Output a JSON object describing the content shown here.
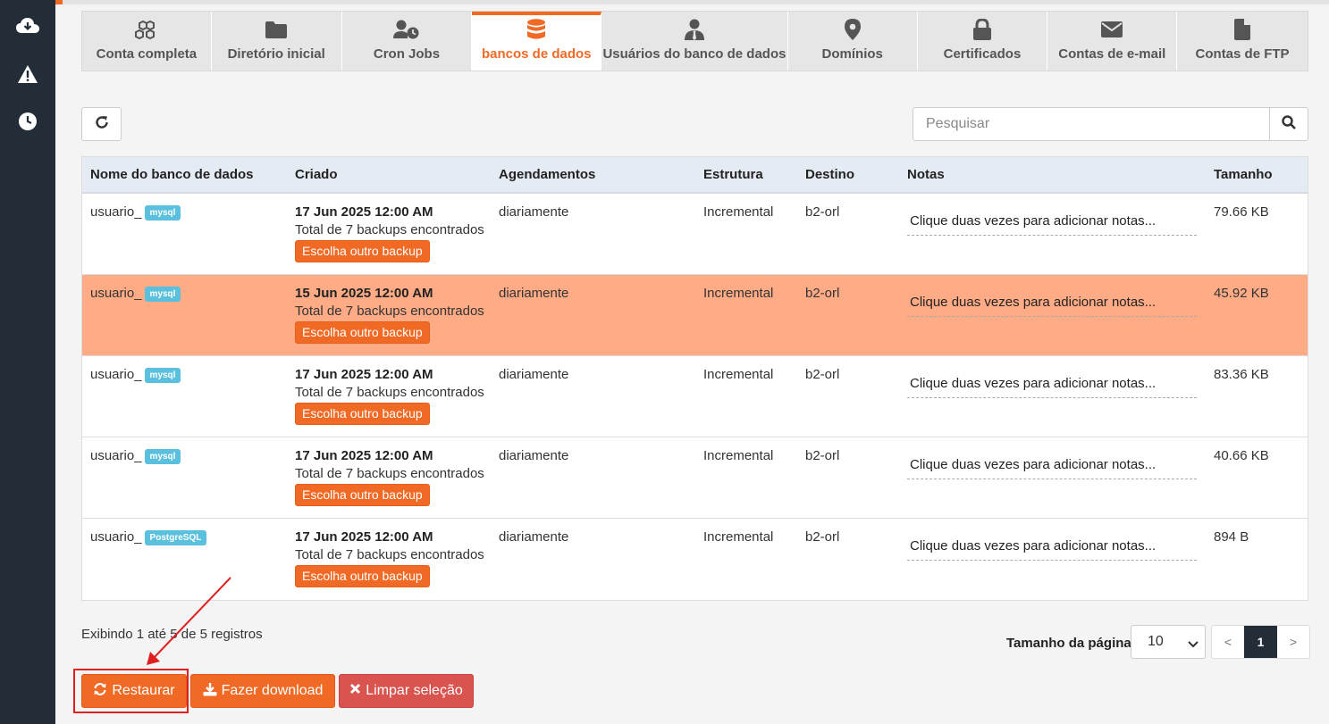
{
  "sidebar": {
    "icons": [
      "cloud-download-icon",
      "warning-icon",
      "clock-icon"
    ]
  },
  "tabs": [
    {
      "label": "Conta completa",
      "icon": "cubes-icon",
      "active": false
    },
    {
      "label": "Diretório inicial",
      "icon": "folder-icon",
      "active": false
    },
    {
      "label": "Cron Jobs",
      "icon": "user-clock-icon",
      "active": false
    },
    {
      "label": "bancos de dados",
      "icon": "database-icon",
      "active": true
    },
    {
      "label": "Usuários do banco de dados",
      "icon": "user-tie-icon",
      "active": false
    },
    {
      "label": "Domínios",
      "icon": "map-marker-icon",
      "active": false
    },
    {
      "label": "Certificados",
      "icon": "lock-icon",
      "active": false
    },
    {
      "label": "Contas de e-mail",
      "icon": "envelope-icon",
      "active": false
    },
    {
      "label": "Contas de FTP",
      "icon": "file-icon",
      "active": false
    }
  ],
  "search": {
    "placeholder": "Pesquisar",
    "value": ""
  },
  "table": {
    "headers": [
      "Nome do banco de dados",
      "Criado",
      "Agendamentos",
      "Estrutura",
      "Destino",
      "Notas",
      "Tamanho"
    ],
    "rows": [
      {
        "name": "usuario_",
        "type": "mysql",
        "date": "17 Jun 2025 12:00 AM",
        "total": "Total de 7 backups encontrados",
        "pick": "Escolha outro backup",
        "schedule": "diariamente",
        "structure": "Incremental",
        "destination": "b2-orl",
        "notes": "Clique duas vezes para adicionar notas...",
        "size": "79.66 KB",
        "selected": false
      },
      {
        "name": "usuario_",
        "type": "mysql",
        "date": "15 Jun 2025 12:00 AM",
        "total": "Total de 7 backups encontrados",
        "pick": "Escolha outro backup",
        "schedule": "diariamente",
        "structure": "Incremental",
        "destination": "b2-orl",
        "notes": "Clique duas vezes para adicionar notas...",
        "size": "45.92 KB",
        "selected": true
      },
      {
        "name": "usuario_",
        "type": "mysql",
        "date": "17 Jun 2025 12:00 AM",
        "total": "Total de 7 backups encontrados",
        "pick": "Escolha outro backup",
        "schedule": "diariamente",
        "structure": "Incremental",
        "destination": "b2-orl",
        "notes": "Clique duas vezes para adicionar notas...",
        "size": "83.36 KB",
        "selected": false
      },
      {
        "name": "usuario_",
        "type": "mysql",
        "date": "17 Jun 2025 12:00 AM",
        "total": "Total de 7 backups encontrados",
        "pick": "Escolha outro backup",
        "schedule": "diariamente",
        "structure": "Incremental",
        "destination": "b2-orl",
        "notes": "Clique duas vezes para adicionar notas...",
        "size": "40.66 KB",
        "selected": false
      },
      {
        "name": "usuario_",
        "type": "PostgreSQL",
        "date": "17 Jun 2025 12:00 AM",
        "total": "Total de 7 backups encontrados",
        "pick": "Escolha outro backup",
        "schedule": "diariamente",
        "structure": "Incremental",
        "destination": "b2-orl",
        "notes": "Clique duas vezes para adicionar notas...",
        "size": "894 B",
        "selected": false
      }
    ]
  },
  "footer": {
    "info": "Exibindo 1 até 5 de 5 registros",
    "page_size_label": "Tamanho da página",
    "page_size_value": "10",
    "pager": {
      "prev": "<",
      "current": "1",
      "next": ">"
    }
  },
  "actions": {
    "restore": "Restaurar",
    "download": "Fazer download",
    "clear": "Limpar seleção"
  },
  "colors": {
    "accent": "#f06a25",
    "selected_row": "#ffab86",
    "danger": "#d9534f",
    "sidebar": "#222d38",
    "badge": "#5bc0de",
    "annotation": "#e02020"
  }
}
